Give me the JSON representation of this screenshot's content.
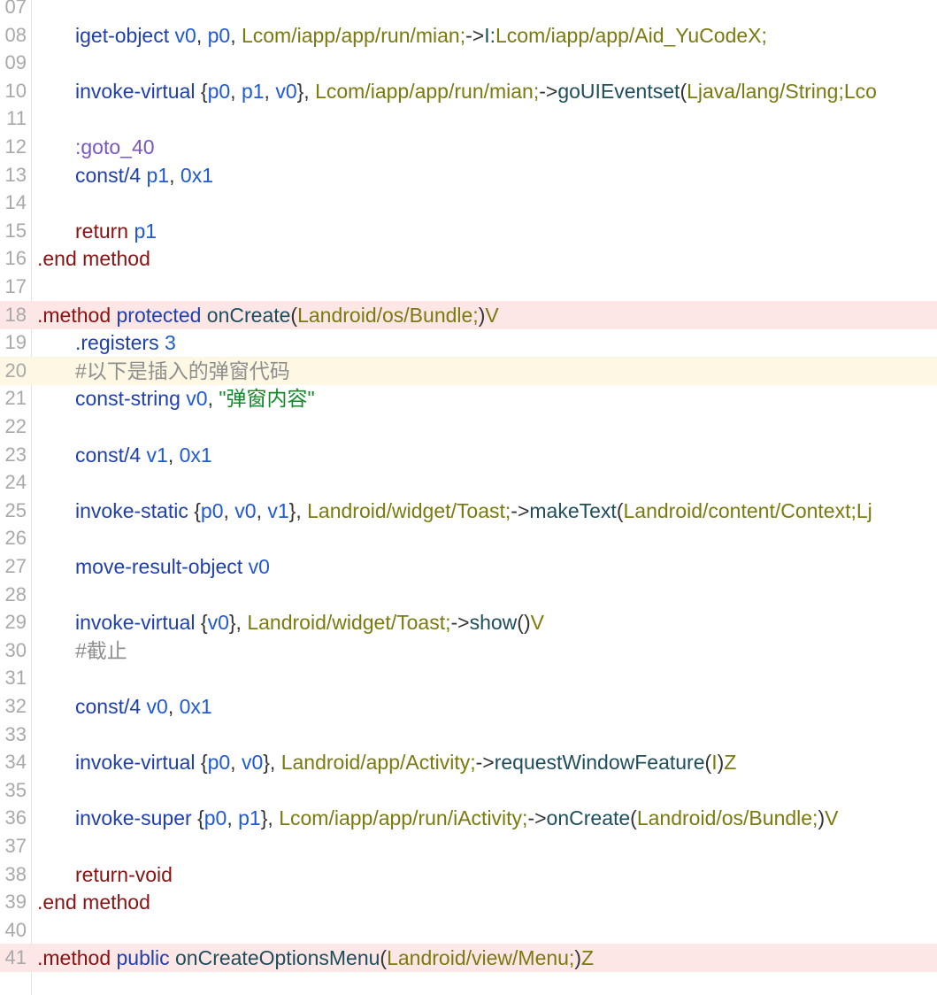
{
  "editor": {
    "lines": [
      {
        "num": "07",
        "hl": "",
        "indent": 1,
        "tokens": []
      },
      {
        "num": "08",
        "hl": "",
        "indent": 1,
        "tokens": [
          {
            "t": "iget-object",
            "c": "kw"
          },
          {
            "t": " "
          },
          {
            "t": "v0",
            "c": "reg"
          },
          {
            "t": ", ",
            "c": "punc"
          },
          {
            "t": "p0",
            "c": "reg"
          },
          {
            "t": ", ",
            "c": "punc"
          },
          {
            "t": "Lcom/iapp/app/run/mian;",
            "c": "type"
          },
          {
            "t": "->",
            "c": "punc"
          },
          {
            "t": "I:",
            "c": "meth"
          },
          {
            "t": "Lcom/iapp/app/Aid_YuCodeX;",
            "c": "type"
          }
        ]
      },
      {
        "num": "09",
        "hl": "",
        "indent": 1,
        "tokens": []
      },
      {
        "num": "10",
        "hl": "",
        "indent": 1,
        "tokens": [
          {
            "t": "invoke-virtual",
            "c": "kw"
          },
          {
            "t": " {",
            "c": "punc"
          },
          {
            "t": "p0",
            "c": "reg"
          },
          {
            "t": ", ",
            "c": "punc"
          },
          {
            "t": "p1",
            "c": "reg"
          },
          {
            "t": ", ",
            "c": "punc"
          },
          {
            "t": "v0",
            "c": "reg"
          },
          {
            "t": "}, ",
            "c": "punc"
          },
          {
            "t": "Lcom/iapp/app/run/mian;",
            "c": "type"
          },
          {
            "t": "->",
            "c": "punc"
          },
          {
            "t": "goUIEventset",
            "c": "meth"
          },
          {
            "t": "(",
            "c": "punc"
          },
          {
            "t": "Ljava/lang/String;Lco",
            "c": "type"
          }
        ]
      },
      {
        "num": "11",
        "hl": "",
        "indent": 1,
        "tokens": []
      },
      {
        "num": "12",
        "hl": "",
        "indent": 1,
        "tokens": [
          {
            "t": ":goto_40",
            "c": "label"
          }
        ]
      },
      {
        "num": "13",
        "hl": "",
        "indent": 1,
        "tokens": [
          {
            "t": "const/4",
            "c": "kw"
          },
          {
            "t": " "
          },
          {
            "t": "p1",
            "c": "reg"
          },
          {
            "t": ", ",
            "c": "punc"
          },
          {
            "t": "0x1",
            "c": "reg"
          }
        ]
      },
      {
        "num": "14",
        "hl": "",
        "indent": 1,
        "tokens": []
      },
      {
        "num": "15",
        "hl": "",
        "indent": 1,
        "tokens": [
          {
            "t": "return",
            "c": "dir"
          },
          {
            "t": " "
          },
          {
            "t": "p1",
            "c": "reg"
          }
        ]
      },
      {
        "num": "16",
        "hl": "",
        "indent": 0,
        "tokens": [
          {
            "t": ".end",
            "c": "dir"
          },
          {
            "t": " "
          },
          {
            "t": "method",
            "c": "dir"
          }
        ]
      },
      {
        "num": "17",
        "hl": "",
        "indent": 0,
        "tokens": []
      },
      {
        "num": "18",
        "hl": "red",
        "indent": 0,
        "tokens": [
          {
            "t": ".method",
            "c": "dir"
          },
          {
            "t": " "
          },
          {
            "t": "protected",
            "c": "kw"
          },
          {
            "t": " "
          },
          {
            "t": "onCreate",
            "c": "meth"
          },
          {
            "t": "(",
            "c": "punc"
          },
          {
            "t": "Landroid/os/Bundle;",
            "c": "type"
          },
          {
            "t": ")",
            "c": "punc"
          },
          {
            "t": "V",
            "c": "type"
          }
        ]
      },
      {
        "num": "19",
        "hl": "",
        "indent": 1,
        "tokens": [
          {
            "t": ".registers",
            "c": "kw"
          },
          {
            "t": " "
          },
          {
            "t": "3",
            "c": "reg"
          }
        ]
      },
      {
        "num": "20",
        "hl": "yellow",
        "indent": 1,
        "tokens": [
          {
            "t": "#以下是插入的弹窗代码",
            "c": "com"
          }
        ]
      },
      {
        "num": "21",
        "hl": "",
        "indent": 1,
        "tokens": [
          {
            "t": "const-string",
            "c": "kw"
          },
          {
            "t": " "
          },
          {
            "t": "v0",
            "c": "reg"
          },
          {
            "t": ", ",
            "c": "punc"
          },
          {
            "t": "\"弹窗内容\"",
            "c": "str"
          }
        ]
      },
      {
        "num": "22",
        "hl": "",
        "indent": 1,
        "tokens": []
      },
      {
        "num": "23",
        "hl": "",
        "indent": 1,
        "tokens": [
          {
            "t": "const/4",
            "c": "kw"
          },
          {
            "t": " "
          },
          {
            "t": "v1",
            "c": "reg"
          },
          {
            "t": ", ",
            "c": "punc"
          },
          {
            "t": "0x1",
            "c": "reg"
          }
        ]
      },
      {
        "num": "24",
        "hl": "",
        "indent": 1,
        "tokens": []
      },
      {
        "num": "25",
        "hl": "",
        "indent": 1,
        "tokens": [
          {
            "t": "invoke-static",
            "c": "kw"
          },
          {
            "t": " {",
            "c": "punc"
          },
          {
            "t": "p0",
            "c": "reg"
          },
          {
            "t": ", ",
            "c": "punc"
          },
          {
            "t": "v0",
            "c": "reg"
          },
          {
            "t": ", ",
            "c": "punc"
          },
          {
            "t": "v1",
            "c": "reg"
          },
          {
            "t": "}, ",
            "c": "punc"
          },
          {
            "t": "Landroid/widget/Toast;",
            "c": "type"
          },
          {
            "t": "->",
            "c": "punc"
          },
          {
            "t": "makeText",
            "c": "meth"
          },
          {
            "t": "(",
            "c": "punc"
          },
          {
            "t": "Landroid/content/Context;Lj",
            "c": "type"
          }
        ]
      },
      {
        "num": "26",
        "hl": "",
        "indent": 1,
        "tokens": []
      },
      {
        "num": "27",
        "hl": "",
        "indent": 1,
        "tokens": [
          {
            "t": "move-result-object",
            "c": "kw"
          },
          {
            "t": " "
          },
          {
            "t": "v0",
            "c": "reg"
          }
        ]
      },
      {
        "num": "28",
        "hl": "",
        "indent": 1,
        "tokens": []
      },
      {
        "num": "29",
        "hl": "",
        "indent": 1,
        "tokens": [
          {
            "t": "invoke-virtual",
            "c": "kw"
          },
          {
            "t": " {",
            "c": "punc"
          },
          {
            "t": "v0",
            "c": "reg"
          },
          {
            "t": "}, ",
            "c": "punc"
          },
          {
            "t": "Landroid/widget/Toast;",
            "c": "type"
          },
          {
            "t": "->",
            "c": "punc"
          },
          {
            "t": "show",
            "c": "meth"
          },
          {
            "t": "()",
            "c": "punc"
          },
          {
            "t": "V",
            "c": "type"
          }
        ]
      },
      {
        "num": "30",
        "hl": "",
        "indent": 1,
        "tokens": [
          {
            "t": "#截止",
            "c": "com"
          }
        ]
      },
      {
        "num": "31",
        "hl": "",
        "indent": 1,
        "tokens": []
      },
      {
        "num": "32",
        "hl": "",
        "indent": 1,
        "tokens": [
          {
            "t": "const/4",
            "c": "kw"
          },
          {
            "t": " "
          },
          {
            "t": "v0",
            "c": "reg"
          },
          {
            "t": ", ",
            "c": "punc"
          },
          {
            "t": "0x1",
            "c": "reg"
          }
        ]
      },
      {
        "num": "33",
        "hl": "",
        "indent": 1,
        "tokens": []
      },
      {
        "num": "34",
        "hl": "",
        "indent": 1,
        "tokens": [
          {
            "t": "invoke-virtual",
            "c": "kw"
          },
          {
            "t": " {",
            "c": "punc"
          },
          {
            "t": "p0",
            "c": "reg"
          },
          {
            "t": ", ",
            "c": "punc"
          },
          {
            "t": "v0",
            "c": "reg"
          },
          {
            "t": "}, ",
            "c": "punc"
          },
          {
            "t": "Landroid/app/Activity;",
            "c": "type"
          },
          {
            "t": "->",
            "c": "punc"
          },
          {
            "t": "requestWindowFeature",
            "c": "meth"
          },
          {
            "t": "(",
            "c": "punc"
          },
          {
            "t": "I",
            "c": "type"
          },
          {
            "t": ")",
            "c": "punc"
          },
          {
            "t": "Z",
            "c": "type"
          }
        ]
      },
      {
        "num": "35",
        "hl": "",
        "indent": 1,
        "tokens": []
      },
      {
        "num": "36",
        "hl": "",
        "indent": 1,
        "tokens": [
          {
            "t": "invoke-super",
            "c": "kw"
          },
          {
            "t": " {",
            "c": "punc"
          },
          {
            "t": "p0",
            "c": "reg"
          },
          {
            "t": ", ",
            "c": "punc"
          },
          {
            "t": "p1",
            "c": "reg"
          },
          {
            "t": "}, ",
            "c": "punc"
          },
          {
            "t": "Lcom/iapp/app/run/iActivity;",
            "c": "type"
          },
          {
            "t": "->",
            "c": "punc"
          },
          {
            "t": "onCreate",
            "c": "meth"
          },
          {
            "t": "(",
            "c": "punc"
          },
          {
            "t": "Landroid/os/Bundle;",
            "c": "type"
          },
          {
            "t": ")",
            "c": "punc"
          },
          {
            "t": "V",
            "c": "type"
          }
        ]
      },
      {
        "num": "37",
        "hl": "",
        "indent": 1,
        "tokens": []
      },
      {
        "num": "38",
        "hl": "",
        "indent": 1,
        "tokens": [
          {
            "t": "return-void",
            "c": "dir"
          }
        ]
      },
      {
        "num": "39",
        "hl": "",
        "indent": 0,
        "tokens": [
          {
            "t": ".end",
            "c": "dir"
          },
          {
            "t": " "
          },
          {
            "t": "method",
            "c": "dir"
          }
        ]
      },
      {
        "num": "40",
        "hl": "",
        "indent": 0,
        "tokens": []
      },
      {
        "num": "41",
        "hl": "red",
        "indent": 0,
        "tokens": [
          {
            "t": ".method",
            "c": "dir"
          },
          {
            "t": " "
          },
          {
            "t": "public",
            "c": "kw"
          },
          {
            "t": " "
          },
          {
            "t": "onCreateOptionsMenu",
            "c": "meth"
          },
          {
            "t": "(",
            "c": "punc"
          },
          {
            "t": "Landroid/view/Menu;",
            "c": "type"
          },
          {
            "t": ")",
            "c": "punc"
          },
          {
            "t": "Z",
            "c": "type"
          }
        ]
      }
    ]
  }
}
